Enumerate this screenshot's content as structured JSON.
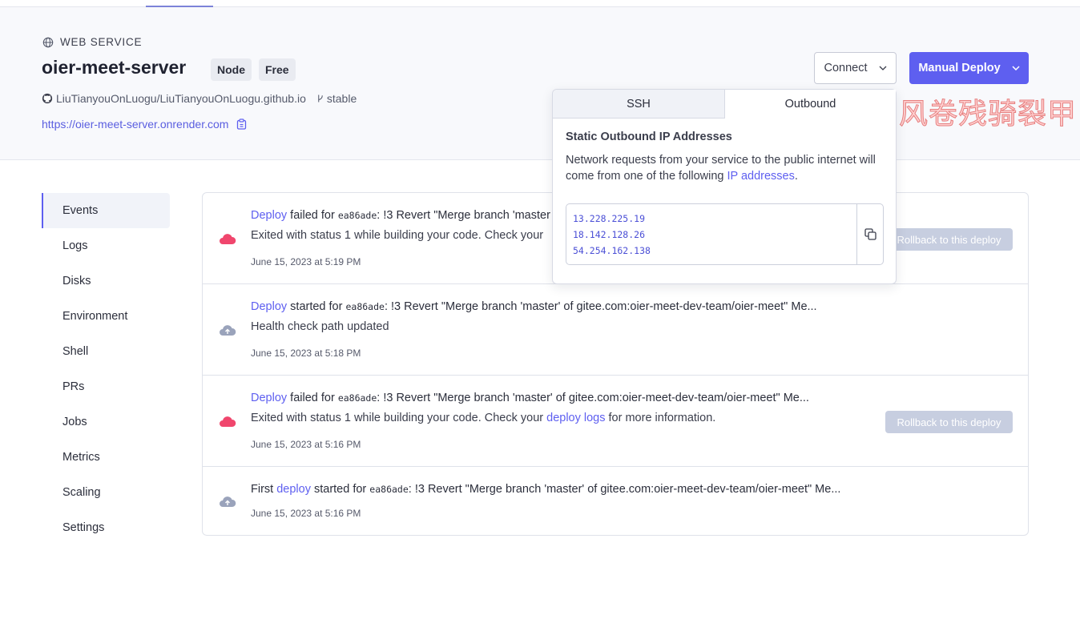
{
  "header": {
    "service_type": "WEB SERVICE",
    "service_name": "oier-meet-server",
    "tags": [
      "Node",
      "Free"
    ],
    "repo": "LiuTianyouOnLuogu/LiuTianyouOnLuogu.github.io",
    "branch": "stable",
    "url": "https://oier-meet-server.onrender.com",
    "connect_label": "Connect",
    "manual_deploy_label": "Manual Deploy"
  },
  "watermark": "风卷残骑裂甲",
  "nav": {
    "items": [
      "Events",
      "Logs",
      "Disks",
      "Environment",
      "Shell",
      "PRs",
      "Jobs",
      "Metrics",
      "Scaling",
      "Settings"
    ],
    "active": "Events"
  },
  "events": [
    {
      "status": "failed",
      "prefix": "",
      "link": "Deploy",
      "verb": " failed for ",
      "commit": "ea86ade",
      "message": ": !3 Revert \"Merge branch 'master",
      "detail_pre": "Exited with status 1 while building your code. Check your",
      "detail_link": "",
      "detail_post": "",
      "time": "June 15, 2023 at 5:19 PM",
      "rollback": "Rollback to this deploy"
    },
    {
      "status": "started",
      "prefix": "",
      "link": "Deploy",
      "verb": " started for ",
      "commit": "ea86ade",
      "message": ": !3 Revert \"Merge branch 'master' of gitee.com:oier-meet-dev-team/oier-meet\" Me...",
      "detail_pre": "Health check path updated",
      "detail_link": "",
      "detail_post": "",
      "time": "June 15, 2023 at 5:18 PM",
      "rollback": ""
    },
    {
      "status": "failed",
      "prefix": "",
      "link": "Deploy",
      "verb": " failed for ",
      "commit": "ea86ade",
      "message": ": !3 Revert \"Merge branch 'master' of gitee.com:oier-meet-dev-team/oier-meet\" Me...",
      "detail_pre": "Exited with status 1 while building your code. Check your ",
      "detail_link": "deploy logs",
      "detail_post": " for more information.",
      "time": "June 15, 2023 at 5:16 PM",
      "rollback": "Rollback to this deploy"
    },
    {
      "status": "started",
      "prefix": "First ",
      "link": "deploy",
      "verb": " started for ",
      "commit": "ea86ade",
      "message": ": !3 Revert \"Merge branch 'master' of gitee.com:oier-meet-dev-team/oier-meet\" Me...",
      "detail_pre": "",
      "detail_link": "",
      "detail_post": "",
      "time": "June 15, 2023 at 5:16 PM",
      "rollback": ""
    }
  ],
  "popover": {
    "tabs": [
      "SSH",
      "Outbound"
    ],
    "active_tab": "Outbound",
    "heading": "Static Outbound IP Addresses",
    "desc_pre": "Network requests from your service to the public internet will come from one of the following ",
    "desc_link": "IP addresses",
    "desc_post": ".",
    "ips": [
      "13.228.225.19",
      "18.142.128.26",
      "54.254.162.138"
    ]
  },
  "colors": {
    "accent": "#5e5ff0",
    "failed": "#f0466d",
    "started": "#9aa3bb",
    "rollback_bg": "#c7cee0"
  }
}
